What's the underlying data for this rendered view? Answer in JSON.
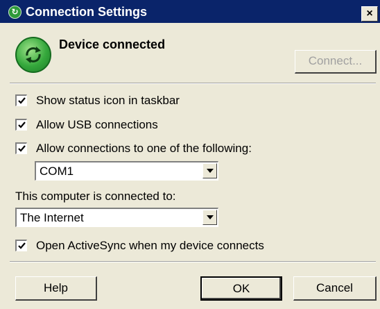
{
  "window": {
    "title": "Connection Settings",
    "close_glyph": "×",
    "title_icon": "sync-arrows-icon"
  },
  "status": {
    "text": "Device connected",
    "icon": "sync-arrows-icon",
    "connect_label": "Connect..."
  },
  "options": {
    "show_status_icon": {
      "label": "Show status icon in taskbar",
      "checked": true
    },
    "allow_usb": {
      "label": "Allow USB connections",
      "checked": true
    },
    "allow_ports": {
      "label": "Allow connections to one of the following:",
      "checked": true
    }
  },
  "port_select": {
    "value": "COM1"
  },
  "network": {
    "label": "This computer is connected to:",
    "value": "The Internet"
  },
  "open_activesync": {
    "label": "Open ActiveSync when my device connects",
    "checked": true
  },
  "buttons": {
    "help": "Help",
    "ok": "OK",
    "cancel": "Cancel"
  },
  "colors": {
    "titlebar": "#0a246a",
    "dialog_bg": "#ece9d8",
    "icon_green": "#35a83c"
  }
}
